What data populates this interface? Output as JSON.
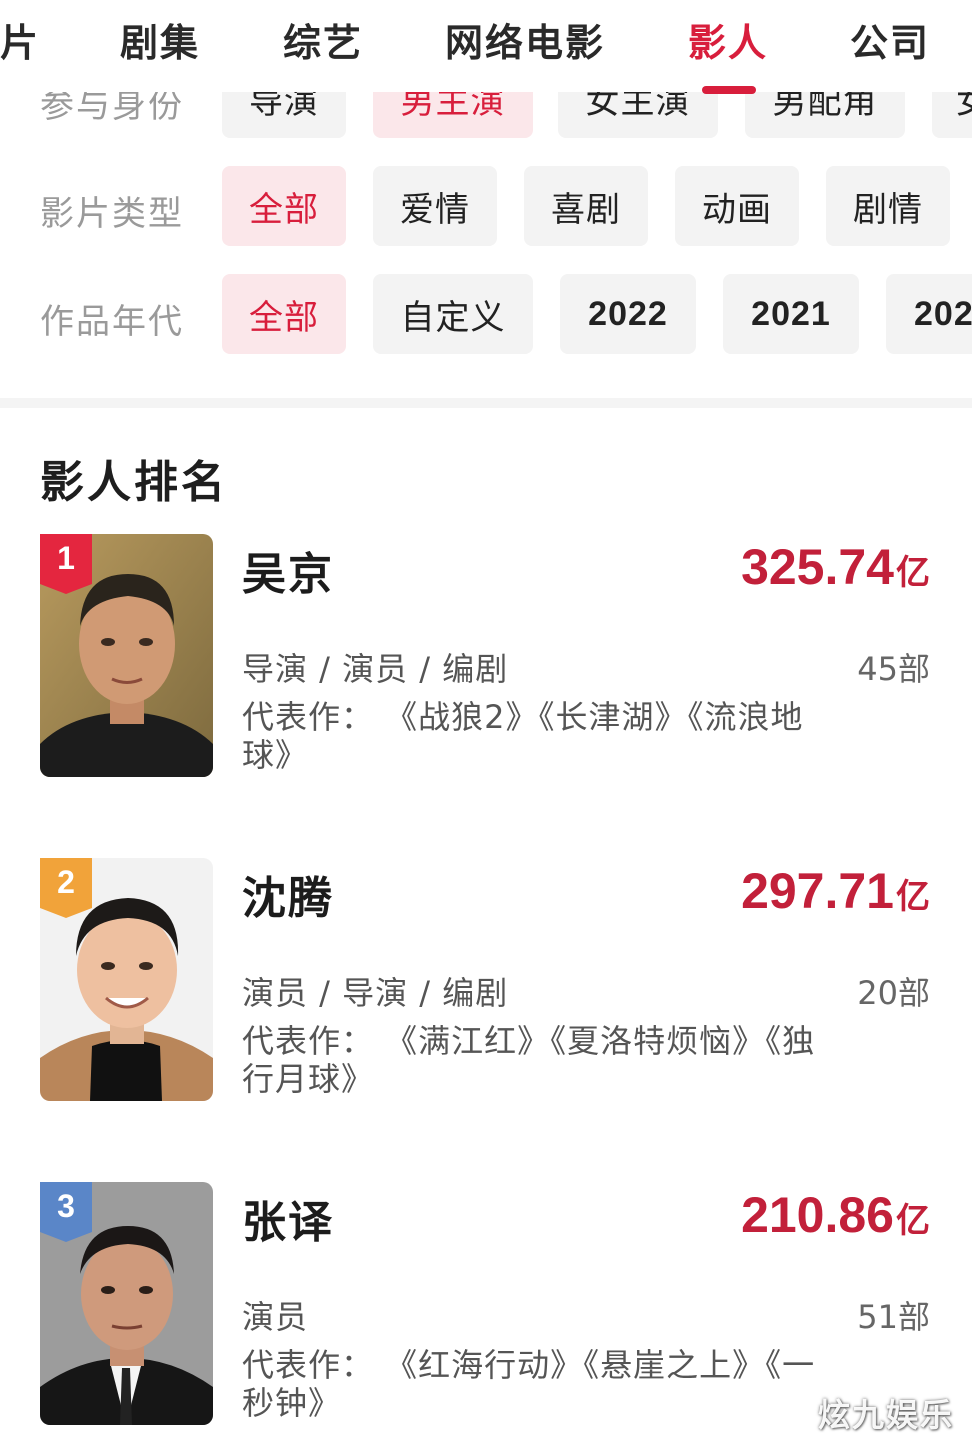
{
  "top_tabs": [
    {
      "label": "片",
      "active": false
    },
    {
      "label": "剧集",
      "active": false
    },
    {
      "label": "综艺",
      "active": false
    },
    {
      "label": "网络电影",
      "active": false
    },
    {
      "label": "影人",
      "active": true
    },
    {
      "label": "公司",
      "active": false
    }
  ],
  "filters": {
    "role": {
      "label": "参与身份",
      "options": [
        "导演",
        "男主演",
        "女主演",
        "男配角",
        "女"
      ],
      "selected": "男主演"
    },
    "genre": {
      "label": "影片类型",
      "options": [
        "全部",
        "爱情",
        "喜剧",
        "动画",
        "剧情"
      ],
      "selected": "全部"
    },
    "year": {
      "label": "作品年代",
      "options": [
        "全部",
        "自定义",
        "2022",
        "2021",
        "202"
      ],
      "selected": "全部"
    }
  },
  "ranking": {
    "title": "影人排名",
    "items": [
      {
        "rank": "1",
        "name": "吴京",
        "box_office": "325.74",
        "unit": "亿",
        "roles": "导演 / 演员 / 编剧",
        "count": "45部",
        "works": "代表作： 《战狼2》《长津湖》《流浪地球》",
        "badge_color": "#e4263f"
      },
      {
        "rank": "2",
        "name": "沈腾",
        "box_office": "297.71",
        "unit": "亿",
        "roles": "演员 / 导演 / 编剧",
        "count": "20部",
        "works": "代表作： 《满江红》《夏洛特烦恼》《独行月球》",
        "badge_color": "#f1a33a"
      },
      {
        "rank": "3",
        "name": "张译",
        "box_office": "210.86",
        "unit": "亿",
        "roles": "演员",
        "count": "51部",
        "works": "代表作： 《红海行动》《悬崖之上》《一秒钟》",
        "badge_color": "#5a86c8"
      }
    ]
  },
  "watermark": "炫九娱乐",
  "colors": {
    "accent": "#d81e3c",
    "box_office": "#c2203a",
    "chip_bg": "#f3f3f3",
    "chip_selected_bg": "#fbe7ea"
  }
}
